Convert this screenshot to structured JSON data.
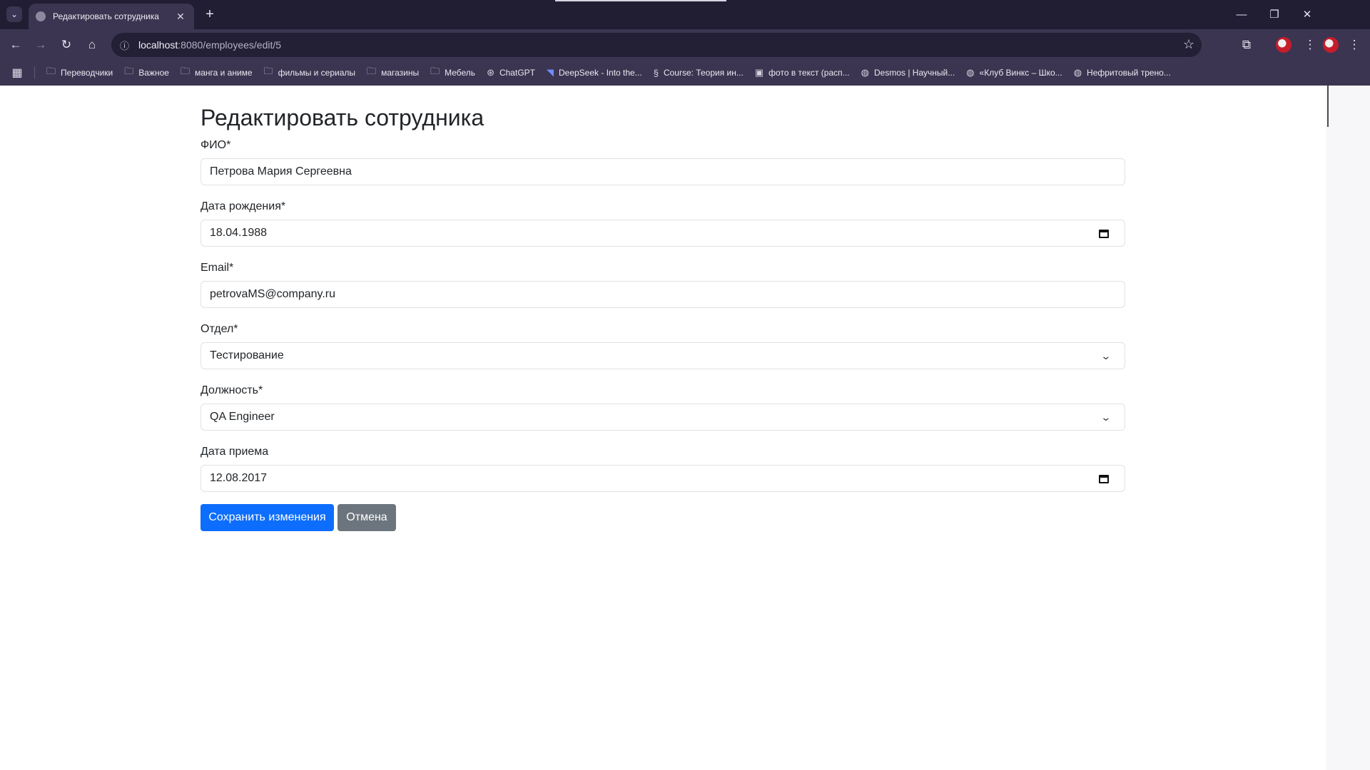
{
  "browser": {
    "tab_title": "Редактировать сотрудника",
    "url_host": "localhost",
    "url_rest": ":8080/employees/edit/5",
    "bookmarks": [
      {
        "label": "Переводчики",
        "icon": "folder-icon"
      },
      {
        "label": "Важное",
        "icon": "folder-icon"
      },
      {
        "label": "манга и аниме",
        "icon": "folder-icon"
      },
      {
        "label": "фильмы и сериалы",
        "icon": "folder-icon"
      },
      {
        "label": "магазины",
        "icon": "folder-icon"
      },
      {
        "label": "Мебель",
        "icon": "folder-icon"
      },
      {
        "label": "ChatGPT",
        "icon": "chatgpt-icon"
      },
      {
        "label": "DeepSeek - Into the...",
        "icon": "deepseek-icon"
      },
      {
        "label": "Course: Теория ин...",
        "icon": "course-icon"
      },
      {
        "label": "фото в текст (расп...",
        "icon": "ocr-icon"
      },
      {
        "label": "Desmos | Научный...",
        "icon": "globe-icon"
      },
      {
        "label": "«Клуб Винкс – Шко...",
        "icon": "globe-icon"
      },
      {
        "label": "Нефритовый трено...",
        "icon": "globe-icon"
      }
    ]
  },
  "form": {
    "title": "Редактировать сотрудника",
    "fields": {
      "full_name": {
        "label": "ФИО*",
        "value": "Петрова Мария Сергеевна"
      },
      "birth_date": {
        "label": "Дата рождения*",
        "value": "18.04.1988"
      },
      "email": {
        "label": "Email*",
        "value": "petrovaMS@company.ru"
      },
      "department": {
        "label": "Отдел*",
        "value": "Тестирование"
      },
      "position": {
        "label": "Должность*",
        "value": "QA Engineer"
      },
      "hire_date": {
        "label": "Дата приема",
        "value": "12.08.2017"
      }
    },
    "save_label": "Сохранить изменения",
    "cancel_label": "Отмена"
  },
  "colors": {
    "primary": "#0d6efd",
    "secondary": "#6c757d",
    "chrome_dark": "#211d33",
    "chrome_toolbar": "#3b3551"
  }
}
